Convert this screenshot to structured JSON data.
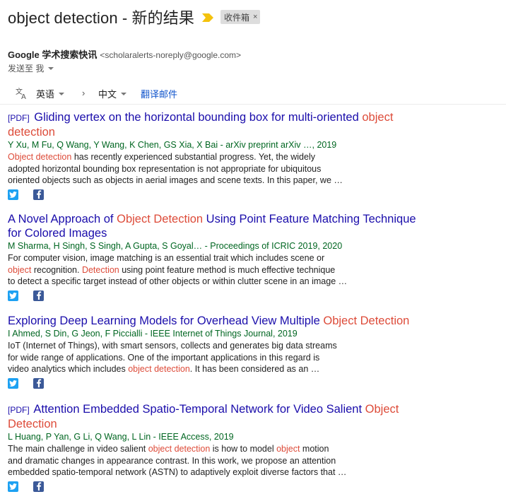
{
  "header": {
    "subject": "object detection - 新的结果",
    "label": "收件箱",
    "label_close": "×"
  },
  "sender": {
    "name": "Google 学术搜索快讯",
    "email": "<scholaralerts-noreply@google.com>",
    "to": "发送至 我"
  },
  "translate": {
    "source_lang": "英语",
    "target_lang": "中文",
    "arrow": "›",
    "action": "翻译邮件"
  },
  "results": [
    {
      "pdf": "[PDF]",
      "title_a": "Gliding vertex on the horizontal bounding box for multi-oriented ",
      "title_hl": "object detection",
      "authors": "Y Xu, M Fu, Q Wang, Y Wang, K Chen, GS Xia, X Bai - arXiv preprint arXiv …, 2019",
      "s1_hl": "Object detection",
      "s1": " has recently experienced substantial progress. Yet, the widely",
      "s2": "adopted horizontal bounding box representation is not appropriate for ubiquitous",
      "s3": "oriented objects such as objects in aerial images and scene texts. In this paper, we …"
    },
    {
      "title_a": "A Novel Approach of ",
      "title_hl": "Object Detection",
      "title_b": " Using Point Feature Matching Technique",
      "title_c": "for Colored Images",
      "authors": "M Sharma, H Singh, S Singh, A Gupta, S Goyal… - Proceedings of ICRIC 2019, 2020",
      "s1": "For computer vision, image matching is an essential trait which includes scene or",
      "s2_hl": "object",
      "s2": " recognition. ",
      "s2_hl2": "Detection",
      "s2b": " using point feature method is much effective technique",
      "s3": "to detect a specific target instead of other objects or within clutter scene in an image …"
    },
    {
      "title_a": "Exploring Deep Learning Models for Overhead View Multiple ",
      "title_hl": "Object Detection",
      "authors": "I Ahmed, S Din, G Jeon, F Piccialli - IEEE Internet of Things Journal, 2019",
      "s1": "IoT (Internet of Things), with smart sensors, collects and generates big data streams",
      "s2": "for wide range of applications. One of the important applications in this regard is",
      "s3a": "video analytics which includes ",
      "s3_hl": "object detection",
      "s3b": ". It has been considered as an …"
    },
    {
      "pdf": "[PDF]",
      "title_a": "Attention Embedded Spatio-Temporal Network for Video Salient ",
      "title_hl": "Object",
      "title_hl2": "Detection",
      "authors": "L Huang, P Yan, G Li, Q Wang, L Lin - IEEE Access, 2019",
      "s1a": "The main challenge in video salient ",
      "s1_hl": "object detection",
      "s1b": " is how to model ",
      "s1_hl2": "object",
      "s1c": " motion",
      "s2": "and dramatic changes in appearance contrast. In this work, we propose an attention",
      "s3": "embedded spatio-temporal network (ASTN) to adaptively exploit diverse factors that …"
    }
  ],
  "icons": {
    "importance": "importance-marker-icon",
    "translate": "translate-icon",
    "twitter": "twitter-icon",
    "facebook": "facebook-icon"
  },
  "colors": {
    "link": "#1a0dab",
    "highlight": "#dd4b39",
    "authors": "#006621",
    "twitter": "#1da1f2",
    "facebook": "#3b5998",
    "importance": "#f4c20d"
  }
}
